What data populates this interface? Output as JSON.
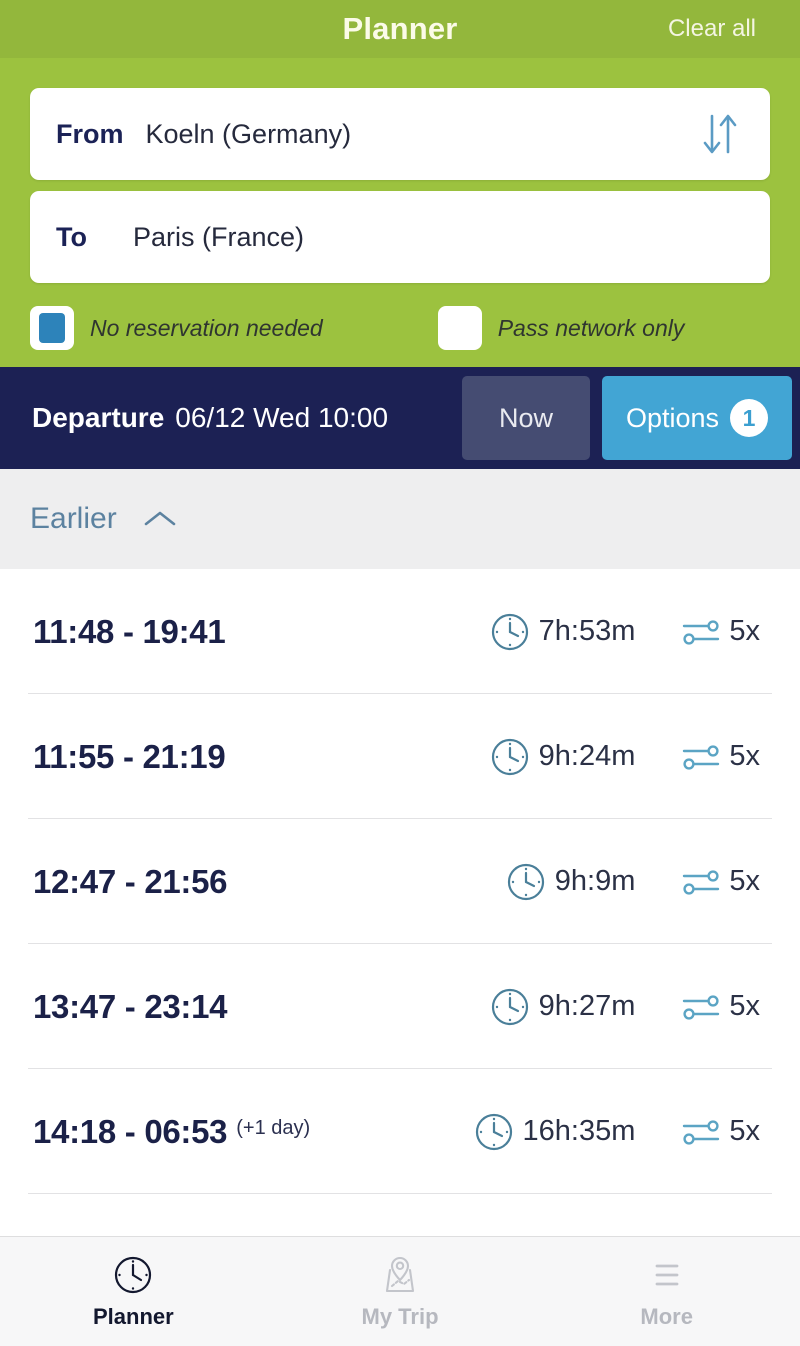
{
  "header": {
    "title": "Planner",
    "clear_all_label": "Clear all",
    "bar_color": "#93b73c",
    "body_color": "#9cc23f"
  },
  "form": {
    "from": {
      "label": "From",
      "value": "Koeln (Germany)"
    },
    "to": {
      "label": "To",
      "value": "Paris (France)"
    },
    "swap_icon": "swap-vertical-arrows-icon",
    "checkboxes": [
      {
        "label": "No reservation needed",
        "checked": true
      },
      {
        "label": "Pass network only",
        "checked": false
      }
    ],
    "checkbox_accent": "#2d83ba"
  },
  "departure": {
    "label": "Departure",
    "datetime": "06/12 Wed 10:00",
    "now_label": "Now",
    "options_label": "Options",
    "options_badge": "1",
    "bar_color": "#1c2154",
    "now_color": "#454c72",
    "options_color": "#42a5d4"
  },
  "earlier": {
    "label": "Earlier",
    "icon": "chevron-up-icon",
    "color": "#5c82a0"
  },
  "results": {
    "duration_icon": "clock-icon",
    "transfers_icon": "transfers-icon",
    "rows": [
      {
        "times": "11:48 - 19:41",
        "next_day": "",
        "duration": "7h:53m",
        "transfers": "5x"
      },
      {
        "times": "11:55 - 21:19",
        "next_day": "",
        "duration": "9h:24m",
        "transfers": "5x"
      },
      {
        "times": "12:47 - 21:56",
        "next_day": "",
        "duration": "9h:9m",
        "transfers": "5x"
      },
      {
        "times": "13:47 - 23:14",
        "next_day": "",
        "duration": "9h:27m",
        "transfers": "5x"
      },
      {
        "times": "14:18 - 06:53",
        "next_day": "(+1 day)",
        "duration": "16h:35m",
        "transfers": "5x"
      }
    ]
  },
  "bottom_nav": {
    "items": [
      {
        "label": "Planner",
        "icon": "clock-icon",
        "active": true
      },
      {
        "label": "My Trip",
        "icon": "map-pin-icon",
        "active": false
      },
      {
        "label": "More",
        "icon": "hamburger-menu-icon",
        "active": false
      }
    ]
  }
}
